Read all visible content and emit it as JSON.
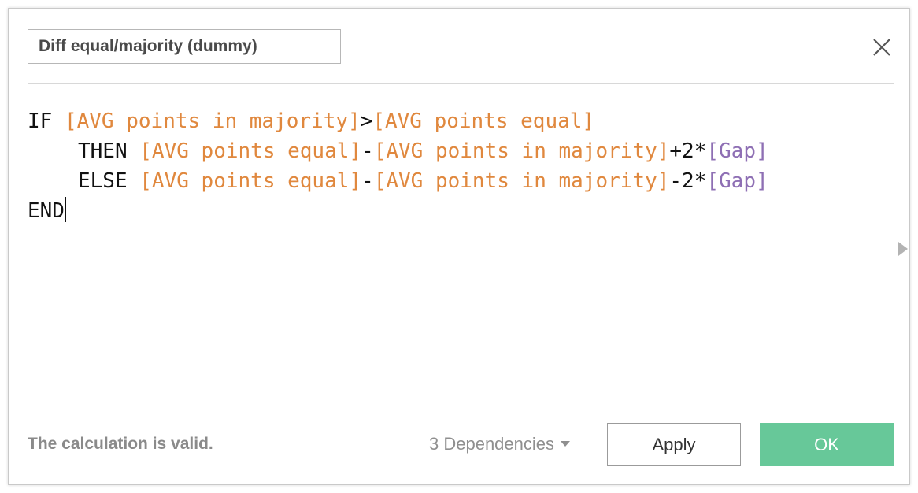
{
  "dialog": {
    "calculation_name": "Diff equal/majority (dummy)",
    "close_icon": "close-icon",
    "expand_icon": "triangle-right-icon"
  },
  "editor": {
    "line1": {
      "kw_if": "IF",
      "field_a": "[AVG points in majority]",
      "op_gt": ">",
      "field_b": "[AVG points equal]"
    },
    "line2": {
      "kw_then": "THEN",
      "field_a": "[AVG points equal]",
      "op_minus": "-",
      "field_b": "[AVG points in majority]",
      "op_plus2": "+2*",
      "param": "[Gap]"
    },
    "line3": {
      "kw_else": "ELSE",
      "field_a": "[AVG points equal]",
      "op_minus": "-",
      "field_b": "[AVG points in majority]",
      "op_minus2": "-2*",
      "param": "[Gap]"
    },
    "line4": {
      "kw_end": "END"
    }
  },
  "footer": {
    "status": "The calculation is valid.",
    "dependencies_label": "3 Dependencies",
    "apply_label": "Apply",
    "ok_label": "OK"
  },
  "colors": {
    "field": "#e0883e",
    "parameter": "#8e6fb4",
    "ok_button": "#67c899"
  }
}
